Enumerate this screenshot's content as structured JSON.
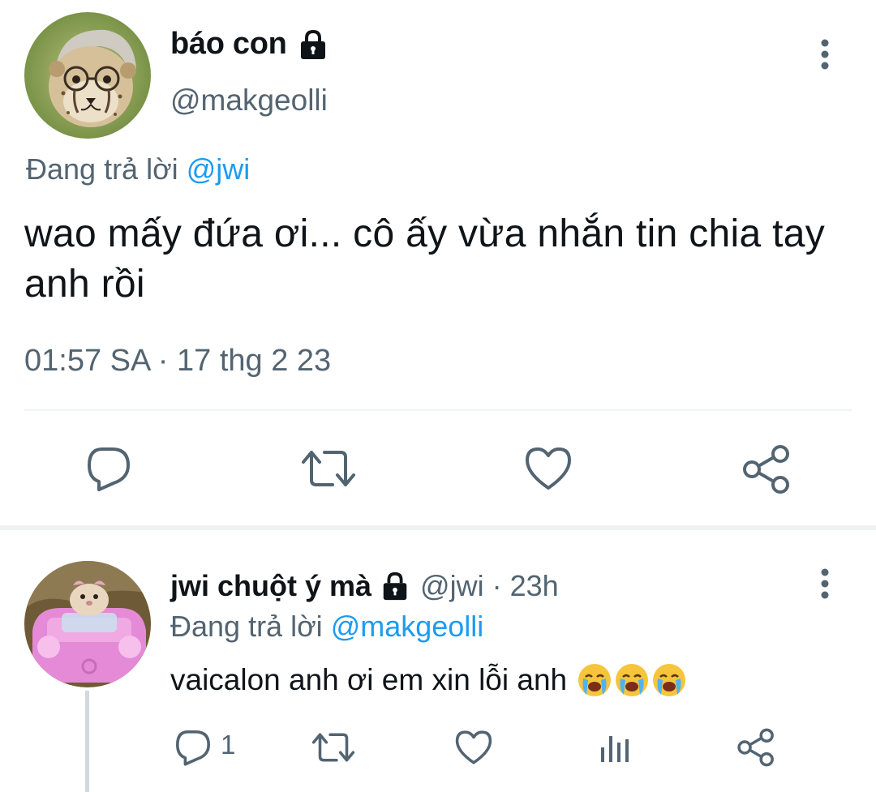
{
  "main_tweet": {
    "display_name": "báo con",
    "handle": "@makgeolli",
    "replying_prefix": "Đang trả lời ",
    "replying_to": "@jwi",
    "text": "wao mấy đứa ơi... cô ấy vừa nhắn tin chia tay anh rồi",
    "timestamp": "01:57 SA · 17 thg 2 23",
    "icons": [
      "reply-icon",
      "retweet-icon",
      "like-icon",
      "share-icon",
      "more-icon",
      "lock-icon"
    ]
  },
  "reply_tweet": {
    "display_name": "jwi chuột ý mà",
    "handle_time": "@jwi · 23h",
    "replying_prefix": "Đang trả lời ",
    "replying_to": "@makgeolli",
    "text": "vaicalon anh ơi em xin lỗi anh",
    "emoji_count": 3,
    "reply_count": "1",
    "icons": [
      "reply-icon",
      "retweet-icon",
      "like-icon",
      "analytics-icon",
      "share-icon",
      "more-icon",
      "lock-icon",
      "crying-face-emoji"
    ]
  },
  "colors": {
    "text_primary": "#0f1419",
    "text_secondary": "#536471",
    "accent": "#1d9bf0",
    "divider": "#eff3f4"
  }
}
